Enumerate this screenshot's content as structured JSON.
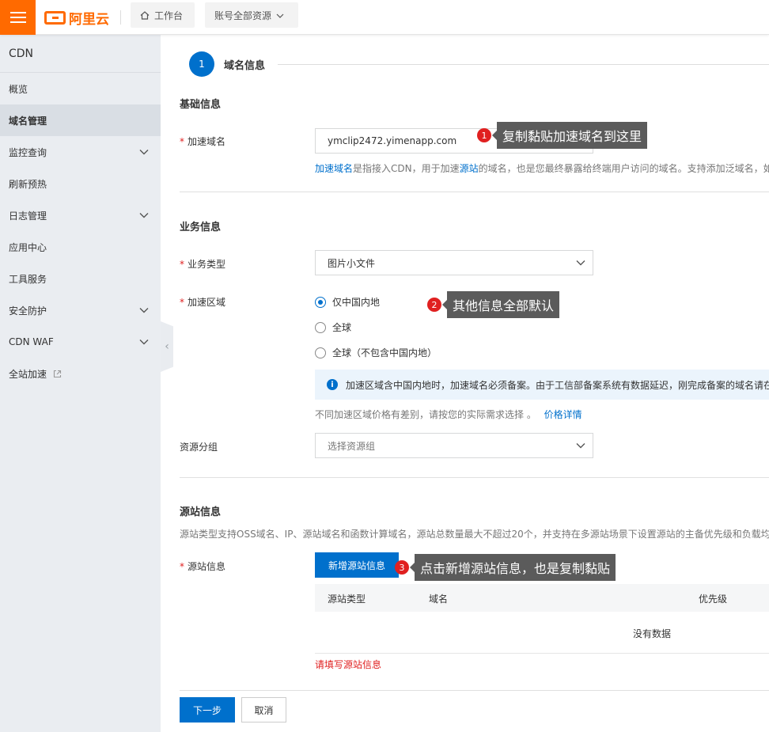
{
  "topbar": {
    "brand": "阿里云",
    "workbench": "工作台",
    "resources": "账号全部资源"
  },
  "sidebar": {
    "title": "CDN",
    "items": [
      {
        "label": "概览"
      },
      {
        "label": "域名管理"
      },
      {
        "label": "监控查询"
      },
      {
        "label": "刷新预热"
      },
      {
        "label": "日志管理"
      },
      {
        "label": "应用中心"
      },
      {
        "label": "工具服务"
      },
      {
        "label": "安全防护"
      },
      {
        "label": "CDN WAF"
      },
      {
        "label": "全站加速"
      }
    ]
  },
  "wizard": {
    "step_number": "1",
    "step_label": "域名信息"
  },
  "basic": {
    "section": "基础信息",
    "domain_label": "加速域名",
    "domain_value": "ymclip2472.yimenapp.com",
    "hint_link1": "加速域名",
    "hint_part1": "是指接入CDN，用于加速",
    "hint_link2": "源站",
    "hint_part2": "的域名，也是您最终暴露给终端用户访问的域名。支持添加泛域名，如"
  },
  "business": {
    "section": "业务信息",
    "type_label": "业务类型",
    "type_value": "图片小文件",
    "region_label": "加速区域",
    "regions": [
      "仅中国内地",
      "全球",
      "全球（不包含中国内地）"
    ],
    "notice": "加速区域含中国内地时，加速域名必须备案。由于工信部备案系统有数据延迟，刚完成备案的域名请在",
    "price_hint": "不同加速区域价格有差别，请按您的实际需求选择 。",
    "price_link": "价格详情",
    "group_label": "资源分组",
    "group_placeholder": "选择资源组"
  },
  "origin": {
    "section": "源站信息",
    "desc": "源站类型支持OSS域名、IP、源站域名和函数计算域名，源站总数量最大不超过20个，并支持在多源站场景下设置源站的主备优先级和负载均衡",
    "label": "源站信息",
    "add_button": "新增源站信息",
    "columns": [
      "源站类型",
      "域名",
      "优先级"
    ],
    "empty": "没有数据",
    "error": "请填写源站信息"
  },
  "footer": {
    "next": "下一步",
    "cancel": "取消"
  },
  "annotations": [
    {
      "num": "1",
      "text": "复制黏贴加速域名到这里"
    },
    {
      "num": "2",
      "text": "其他信息全部默认"
    },
    {
      "num": "3",
      "text": "点击新增源站信息，也是复制黏贴"
    }
  ],
  "colors": {
    "brand": "#ff6a00",
    "primary": "#0070cc",
    "error": "#e02020"
  }
}
